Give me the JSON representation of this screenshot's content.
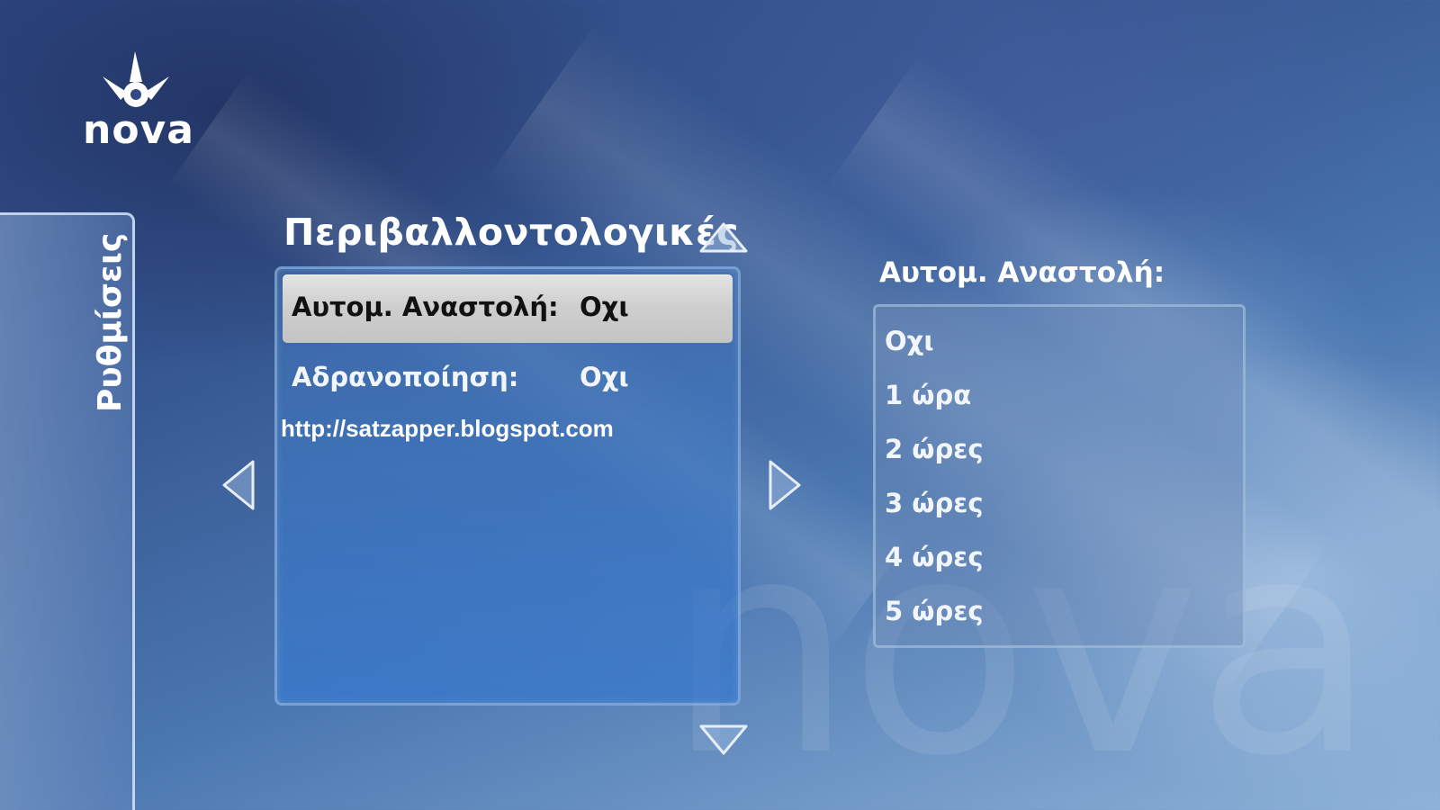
{
  "brand": {
    "logo_text": "nova",
    "watermark_text": "nova"
  },
  "sidebar": {
    "tab_label": "Ρυθμίσεις"
  },
  "settings": {
    "section_title": "Περιβαλλοντολογικές",
    "rows": [
      {
        "label": "Αυτομ. Αναστολή:",
        "value": "Οχι",
        "selected": true
      },
      {
        "label": "Αδρανοποίηση:",
        "value": "Οχι",
        "selected": false
      }
    ],
    "footer_link": "http://satzapper.blogspot.com"
  },
  "options": {
    "title": "Αυτομ. Αναστολή:",
    "items": [
      "Οχι",
      "1 ώρα",
      "2 ώρες",
      "3 ώρες",
      "4 ώρες",
      "5 ώρες"
    ]
  },
  "navigation": {
    "icons": [
      "triangle-up-icon",
      "triangle-down-icon",
      "triangle-left-icon",
      "triangle-right-icon"
    ]
  }
}
